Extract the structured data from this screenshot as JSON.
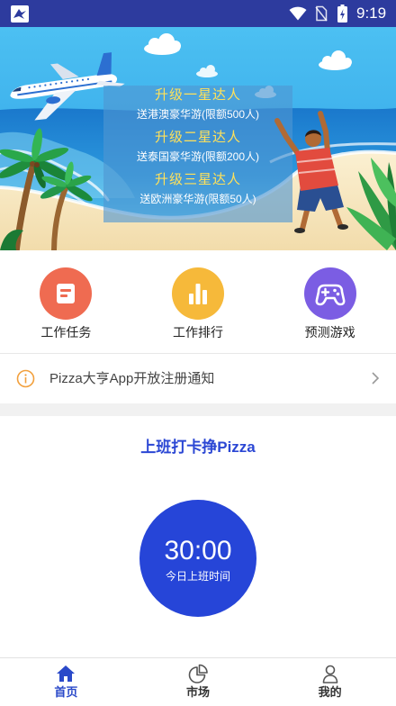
{
  "status_bar": {
    "time": "9:19",
    "icons": [
      "app-logo-icon",
      "wifi-icon",
      "no-sim-icon",
      "battery-charging-icon"
    ]
  },
  "banner": {
    "tiers": [
      {
        "title": "升级一星达人",
        "reward": "送港澳豪华游(限额500人)"
      },
      {
        "title": "升级二星达人",
        "reward": "送泰国豪华游(限额200人)"
      },
      {
        "title": "升级三星达人",
        "reward": "送欧洲豪华游(限额50人)"
      }
    ]
  },
  "quick_actions": [
    {
      "label": "工作任务",
      "icon": "task-document-icon",
      "color": "#ef6b51"
    },
    {
      "label": "工作排行",
      "icon": "ranking-bar-chart-icon",
      "color": "#f6b93a"
    },
    {
      "label": "预测游戏",
      "icon": "gamepad-icon",
      "color": "#7b5de3"
    }
  ],
  "notice": {
    "icon": "info-icon",
    "text": "Pizza大亨App开放注册通知",
    "chevron": "chevron-right-icon"
  },
  "checkin": {
    "title": "上班打卡挣Pizza",
    "timer": "30:00",
    "timer_caption": "今日上班时间"
  },
  "tab_bar": {
    "items": [
      {
        "label": "首页",
        "icon": "home-icon",
        "active": true
      },
      {
        "label": "市场",
        "icon": "pie-chart-icon",
        "active": false
      },
      {
        "label": "我的",
        "icon": "person-icon",
        "active": false
      }
    ]
  },
  "colors": {
    "status_bar": "#2d3b9e",
    "tier_title": "#ffe15a",
    "accent": "#2645d8",
    "checkin_title": "#2b47d4",
    "notice_icon": "#f2a03d",
    "tab_active": "#2a49c9",
    "tab_inactive": "#555555"
  }
}
